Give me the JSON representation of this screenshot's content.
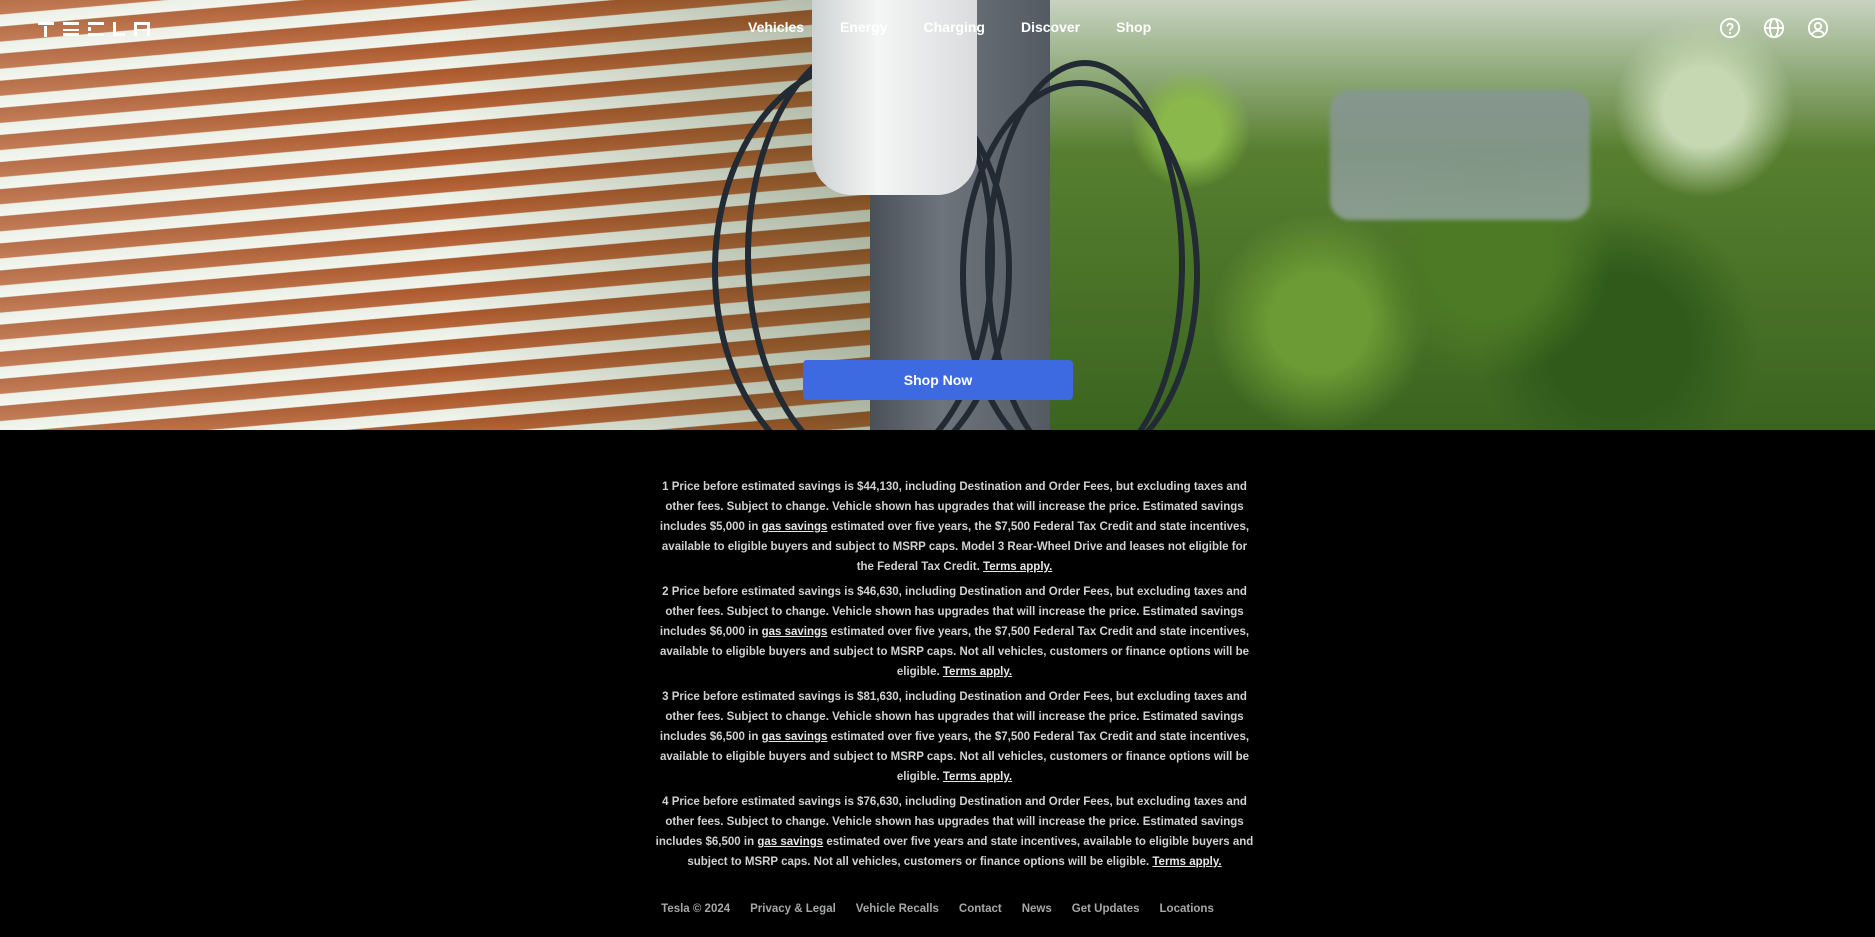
{
  "nav": {
    "logo_text": "TESLA",
    "links": [
      "Vehicles",
      "Energy",
      "Charging",
      "Discover",
      "Shop"
    ],
    "icons": [
      "help-icon",
      "globe-icon",
      "account-icon"
    ]
  },
  "hero": {
    "cta_label": "Shop Now",
    "cta_color": "#3e6ae1"
  },
  "disclaimers": [
    {
      "before": "1 Price before estimated savings is $44,130, including Destination and Order Fees, but excluding taxes and other fees. Subject to change. Vehicle shown has upgrades that will increase the price. Estimated savings includes $5,000 in ",
      "link": "gas savings",
      "after": " estimated over five years, the $7,500 Federal Tax Credit and state incentives, available to eligible buyers and subject to MSRP caps. Model 3 Rear-Wheel Drive and leases not eligible for the Federal Tax Credit. ",
      "terms": "Terms apply."
    },
    {
      "before": "2 Price before estimated savings is $46,630, including Destination and Order Fees, but excluding taxes and other fees. Subject to change. Vehicle shown has upgrades that will increase the price. Estimated savings includes $6,000 in ",
      "link": "gas savings",
      "after": " estimated over five years, the $7,500 Federal Tax Credit and state incentives, available to eligible buyers and subject to MSRP caps. Not all vehicles, customers or finance options will be eligible. ",
      "terms": "Terms apply."
    },
    {
      "before": "3 Price before estimated savings is $81,630, including Destination and Order Fees, but excluding taxes and other fees. Subject to change. Vehicle shown has upgrades that will increase the price. Estimated savings includes $6,500 in ",
      "link": "gas savings",
      "after": " estimated over five years, the $7,500 Federal Tax Credit and state incentives, available to eligible buyers and subject to MSRP caps. Not all vehicles, customers or finance options will be eligible. ",
      "terms": "Terms apply."
    },
    {
      "before": "4 Price before estimated savings is $76,630, including Destination and Order Fees, but excluding taxes and other fees. Subject to change. Vehicle shown has upgrades that will increase the price. Estimated savings includes $6,500 in ",
      "link": "gas savings",
      "after": " estimated over five years and state incentives, available to eligible buyers and subject to MSRP caps. Not all vehicles, customers or finance options will be eligible. ",
      "terms": "Terms apply."
    }
  ],
  "footer": {
    "copyright": "Tesla © 2024",
    "links": [
      "Privacy & Legal",
      "Vehicle Recalls",
      "Contact",
      "News",
      "Get Updates",
      "Locations"
    ]
  }
}
